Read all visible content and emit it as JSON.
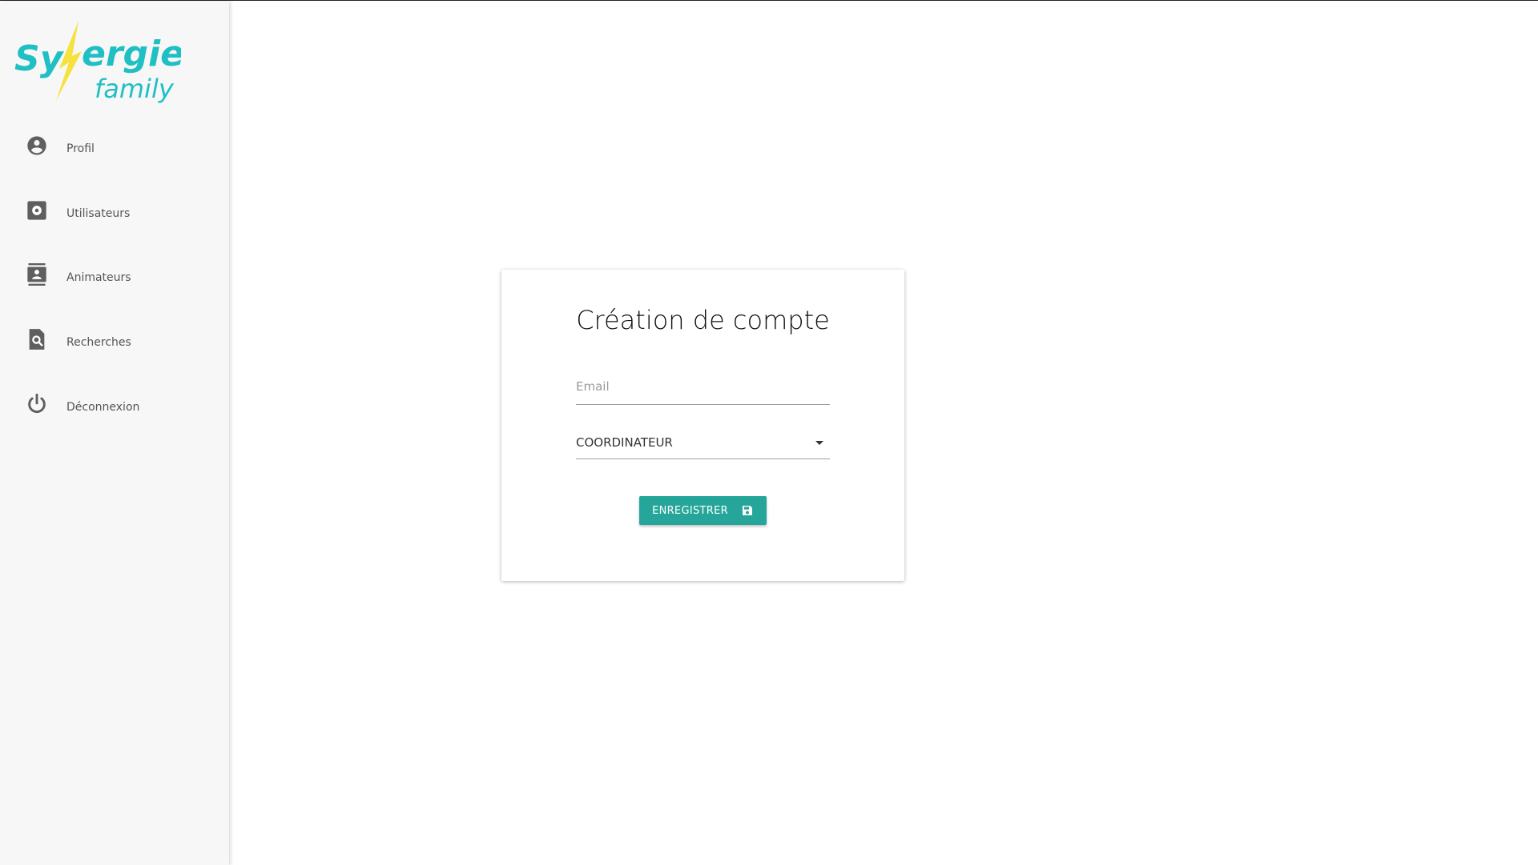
{
  "brand": {
    "logo_text": "Synergie family",
    "colors": {
      "teal": "#1fbfc4",
      "yellow": "#f5e23c"
    }
  },
  "sidebar": {
    "items": [
      {
        "label": "Profil",
        "icon": "account-circle-icon"
      },
      {
        "label": "Utilisateurs",
        "icon": "settings-box-icon"
      },
      {
        "label": "Animateurs",
        "icon": "contacts-icon"
      },
      {
        "label": "Recherches",
        "icon": "find-in-page-icon"
      },
      {
        "label": "Déconnexion",
        "icon": "power-icon"
      }
    ]
  },
  "form": {
    "title": "Création de compte",
    "email_placeholder": "Email",
    "role_value": "COORDINATEUR",
    "submit_label": "ENREGISTRER",
    "accent": "#26a69a"
  }
}
